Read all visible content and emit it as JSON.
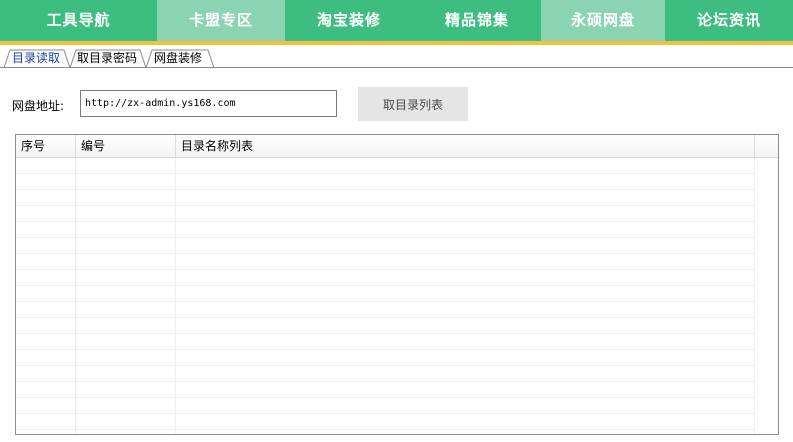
{
  "nav": {
    "items": [
      {
        "label": "工具导航"
      },
      {
        "label": "卡盟专区"
      },
      {
        "label": "淘宝装修"
      },
      {
        "label": "精品锦集"
      },
      {
        "label": "永硕网盘"
      },
      {
        "label": "论坛资讯"
      }
    ],
    "active_indices": [
      1,
      4
    ]
  },
  "tabs": {
    "items": [
      {
        "label": "目录读取"
      },
      {
        "label": "取目录密码"
      },
      {
        "label": "网盘装修"
      }
    ],
    "active_index": 0
  },
  "address": {
    "label": "网盘地址:",
    "value": "http://zx-admin.ys168.com"
  },
  "fetch_button": {
    "label": "取目录列表"
  },
  "list": {
    "columns": [
      {
        "label": "序号"
      },
      {
        "label": "编号"
      },
      {
        "label": "目录名称列表"
      }
    ],
    "rows": []
  },
  "colors": {
    "nav_bg": "#3ebd80",
    "nav_active_bg": "#8bd4b1",
    "nav_accent": "#f4c13d",
    "tab_active_text": "#1a3fa8"
  }
}
